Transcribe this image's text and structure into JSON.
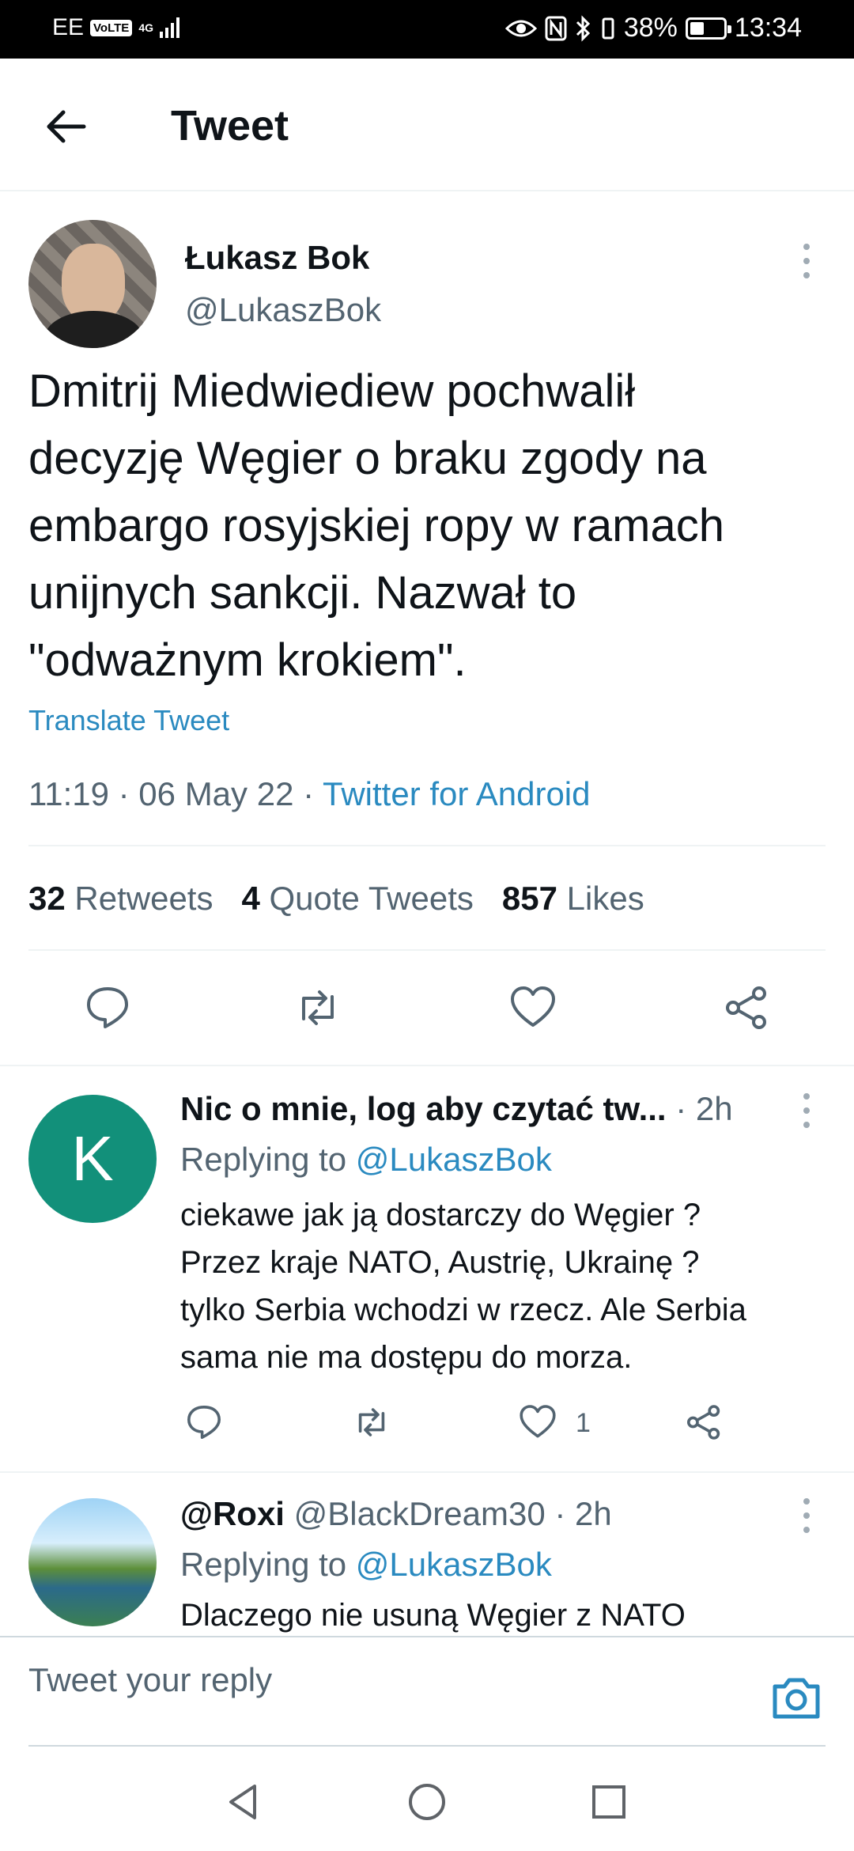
{
  "status_bar": {
    "carrier": "EE",
    "volte": "VoLTE",
    "network": "4G",
    "battery_percent": "38%",
    "time": "13:34",
    "battery_level": 0.38
  },
  "header": {
    "title": "Tweet"
  },
  "tweet": {
    "author_name": "Łukasz Bok",
    "author_handle": "@LukaszBok",
    "text": "Dmitrij Miedwiediew pochwalił\ndecyzję Węgier o braku zgody na\nembargo rosyjskiej ropy w ramach\nunijnych sankcji. Nazwał to\n\"odważnym krokiem\".",
    "translate_label": "Translate Tweet",
    "time": "11:19 · 06 May 22 ·",
    "source": "Twitter for Android",
    "retweets_count": "32",
    "retweets_label": "Retweets",
    "quotes_count": "4",
    "quotes_label": "Quote Tweets",
    "likes_count": "857",
    "likes_label": "Likes"
  },
  "replies": [
    {
      "avatar_letter": "K",
      "display_name": "Nic o mnie, log aby czytać tw...",
      "handle": "",
      "time": "· 2h",
      "replying_prefix": "Replying to",
      "replying_to": "@LukaszBok",
      "text": "ciekawe jak ją dostarczy do Węgier ?\nPrzez kraje NATO, Austrię, Ukrainę ?\ntylko Serbia wchodzi w rzecz. Ale Serbia\nsama nie ma dostępu do morza.",
      "like_count": "1"
    },
    {
      "avatar_letter": "",
      "display_name": "@Roxi",
      "handle": "@BlackDream30",
      "time": "· 2h",
      "replying_prefix": "Replying to",
      "replying_to": "@LukaszBok",
      "text": "Dlaczego nie usuną Węgier z NATO"
    }
  ],
  "reply_bar": {
    "placeholder": "Tweet your reply"
  },
  "colors": {
    "accent": "#2a8ac0",
    "secondary_text": "#536471",
    "avatar_k": "#12907a"
  }
}
